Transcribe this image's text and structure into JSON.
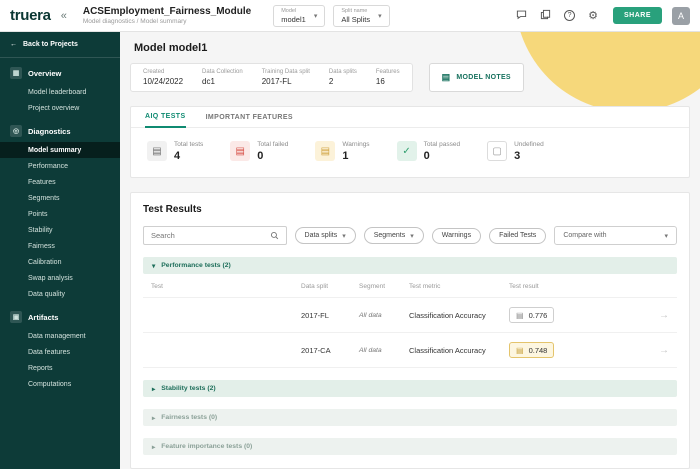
{
  "colors": {
    "brand_teal": "#0d3b38",
    "accent": "#0f8a71",
    "share_green": "#29a17c",
    "deco_yellow": "#f6d87b",
    "mint_group": "#e3efe9",
    "warning_badge_bg": "#fdf6e0",
    "warning_badge_border": "#e4c46c"
  },
  "icons": {
    "collapse": "«",
    "back_arrow": "←",
    "caret_down": "▾",
    "caret_right": "▸",
    "arrow_right": "→",
    "gear": "⚙",
    "help": "?",
    "overview": "▦",
    "diagnostics": "◎",
    "artifacts": "▣",
    "doc": "▤",
    "check": "✓",
    "undefined_doc": "▢"
  },
  "header": {
    "logo": "truera",
    "title": "ACSEmployment_Fairness_Module",
    "breadcrumb": "Model diagnostics / Model summary",
    "model_select": {
      "label": "Model",
      "value": "model1"
    },
    "split_select": {
      "label": "Split name",
      "value": "All Splits"
    },
    "share_label": "SHARE",
    "avatar": "A"
  },
  "sidebar": {
    "back": "Back to Projects",
    "sections": [
      {
        "label": "Overview",
        "items": [
          "Model leaderboard",
          "Project overview"
        ]
      },
      {
        "label": "Diagnostics",
        "items": [
          "Model summary",
          "Performance",
          "Features",
          "Segments",
          "Points",
          "Stability",
          "Fairness",
          "Calibration",
          "Swap analysis",
          "Data quality"
        ]
      },
      {
        "label": "Artifacts",
        "items": [
          "Data management",
          "Data features",
          "Reports",
          "Computations"
        ]
      }
    ]
  },
  "main": {
    "page_title": "Model model1",
    "info": {
      "fields": [
        {
          "label": "Created",
          "value": "10/24/2022"
        },
        {
          "label": "Data Collection",
          "value": "dc1"
        },
        {
          "label": "Training Data split",
          "value": "2017-FL"
        },
        {
          "label": "Data splits",
          "value": "2"
        },
        {
          "label": "Features",
          "value": "16"
        }
      ],
      "notes_button": "MODEL NOTES"
    },
    "tabs": [
      {
        "label": "AIQ TESTS"
      },
      {
        "label": "IMPORTANT FEATURES"
      }
    ],
    "summary": [
      {
        "label": "Total tests",
        "value": "4",
        "glyph": "▤"
      },
      {
        "label": "Total failed",
        "value": "0",
        "glyph": "▤"
      },
      {
        "label": "Warnings",
        "value": "1",
        "glyph": "▤"
      },
      {
        "label": "Total passed",
        "value": "0",
        "glyph": "✓"
      },
      {
        "label": "Undefined",
        "value": "3",
        "glyph": "▢"
      }
    ]
  },
  "test_results": {
    "title": "Test Results",
    "search_placeholder": "Search",
    "filters": [
      "Data splits",
      "Segments",
      "Warnings",
      "Failed Tests"
    ],
    "compare_label": "Compare with",
    "groups": [
      {
        "label": "Performance tests (2)"
      },
      {
        "label": "Stability tests (2)"
      },
      {
        "label": "Fairness tests (0)"
      },
      {
        "label": "Feature importance tests (0)"
      }
    ],
    "table": {
      "headers": [
        "Test",
        "Data split",
        "Segment",
        "Test metric",
        "Test result"
      ],
      "rows": [
        {
          "test": "",
          "split": "2017-FL",
          "segment": "All data",
          "metric": "Classification Accuracy",
          "result": "0.776"
        },
        {
          "test": "",
          "split": "2017-CA",
          "segment": "All data",
          "metric": "Classification Accuracy",
          "result": "0.748"
        }
      ]
    }
  }
}
